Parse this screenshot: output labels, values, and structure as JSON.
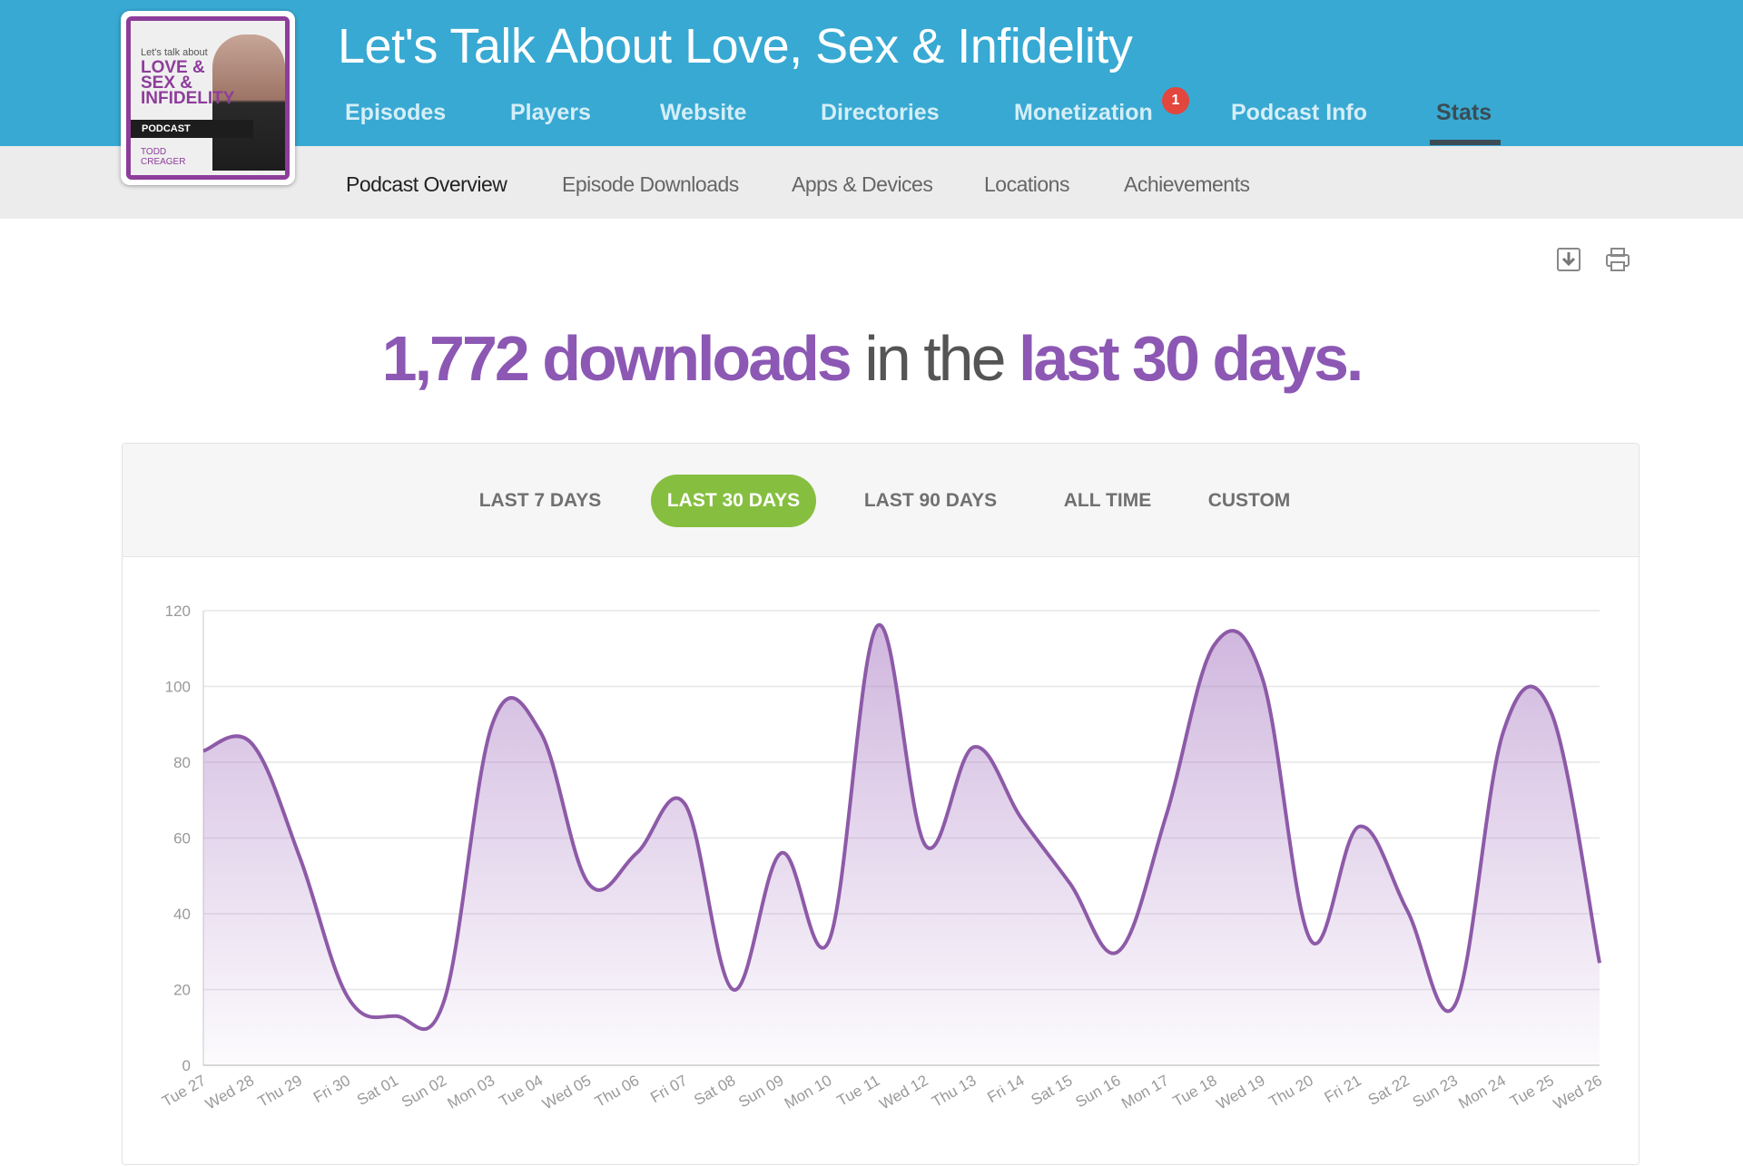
{
  "podcast": {
    "title": "Let's Talk About Love, Sex & Infidelity",
    "cover": {
      "top_text": "Let's talk about",
      "title": "LOVE & SEX & INFIDELITY",
      "band": "PODCAST",
      "author": "TODD CREAGER"
    }
  },
  "nav": {
    "items": [
      {
        "label": "Episodes"
      },
      {
        "label": "Players"
      },
      {
        "label": "Website"
      },
      {
        "label": "Directories"
      },
      {
        "label": "Monetization",
        "badge": "1"
      },
      {
        "label": "Podcast Info"
      },
      {
        "label": "Stats",
        "active": true
      }
    ]
  },
  "subnav": {
    "items": [
      {
        "label": "Podcast Overview",
        "active": true
      },
      {
        "label": "Episode Downloads"
      },
      {
        "label": "Apps & Devices"
      },
      {
        "label": "Locations"
      },
      {
        "label": "Achievements"
      }
    ]
  },
  "toolbar": {
    "icons": [
      "download-icon",
      "print-icon"
    ]
  },
  "headline": {
    "count": "1,772 downloads",
    "middle": " in the ",
    "period": "last 30 days."
  },
  "ranges": {
    "items": [
      {
        "label": "LAST 7 DAYS"
      },
      {
        "label": "LAST 30 DAYS",
        "active": true
      },
      {
        "label": "LAST 90 DAYS"
      },
      {
        "label": "ALL TIME"
      },
      {
        "label": "CUSTOM"
      }
    ]
  },
  "colors": {
    "topbar": "#38a9d2",
    "accent_purple": "#8c58b4",
    "line": "#8d5aa8",
    "active_range": "#86bf40",
    "badge": "#e2463d"
  },
  "chart_data": {
    "type": "area",
    "categories": [
      "Tue 27",
      "Wed 28",
      "Thu 29",
      "Fri 30",
      "Sat 01",
      "Sun 02",
      "Mon 03",
      "Tue 04",
      "Wed 05",
      "Thu 06",
      "Fri 07",
      "Sat 08",
      "Sun 09",
      "Mon 10",
      "Tue 11",
      "Wed 12",
      "Thu 13",
      "Fri 14",
      "Sat 15",
      "Sun 16",
      "Mon 17",
      "Tue 18",
      "Wed 19",
      "Thu 20",
      "Fri 21",
      "Sat 22",
      "Sun 23",
      "Mon 24",
      "Tue 25",
      "Wed 26"
    ],
    "values": [
      83,
      85,
      55,
      18,
      13,
      17,
      90,
      88,
      48,
      56,
      69,
      20,
      56,
      33,
      116,
      58,
      84,
      65,
      48,
      30,
      66,
      111,
      102,
      33,
      63,
      41,
      16,
      88,
      93,
      27
    ],
    "ylim": [
      0,
      120
    ],
    "yticks": [
      "0",
      "20",
      "40",
      "60",
      "80",
      "100",
      "120"
    ],
    "grid": true,
    "legend": "none"
  }
}
